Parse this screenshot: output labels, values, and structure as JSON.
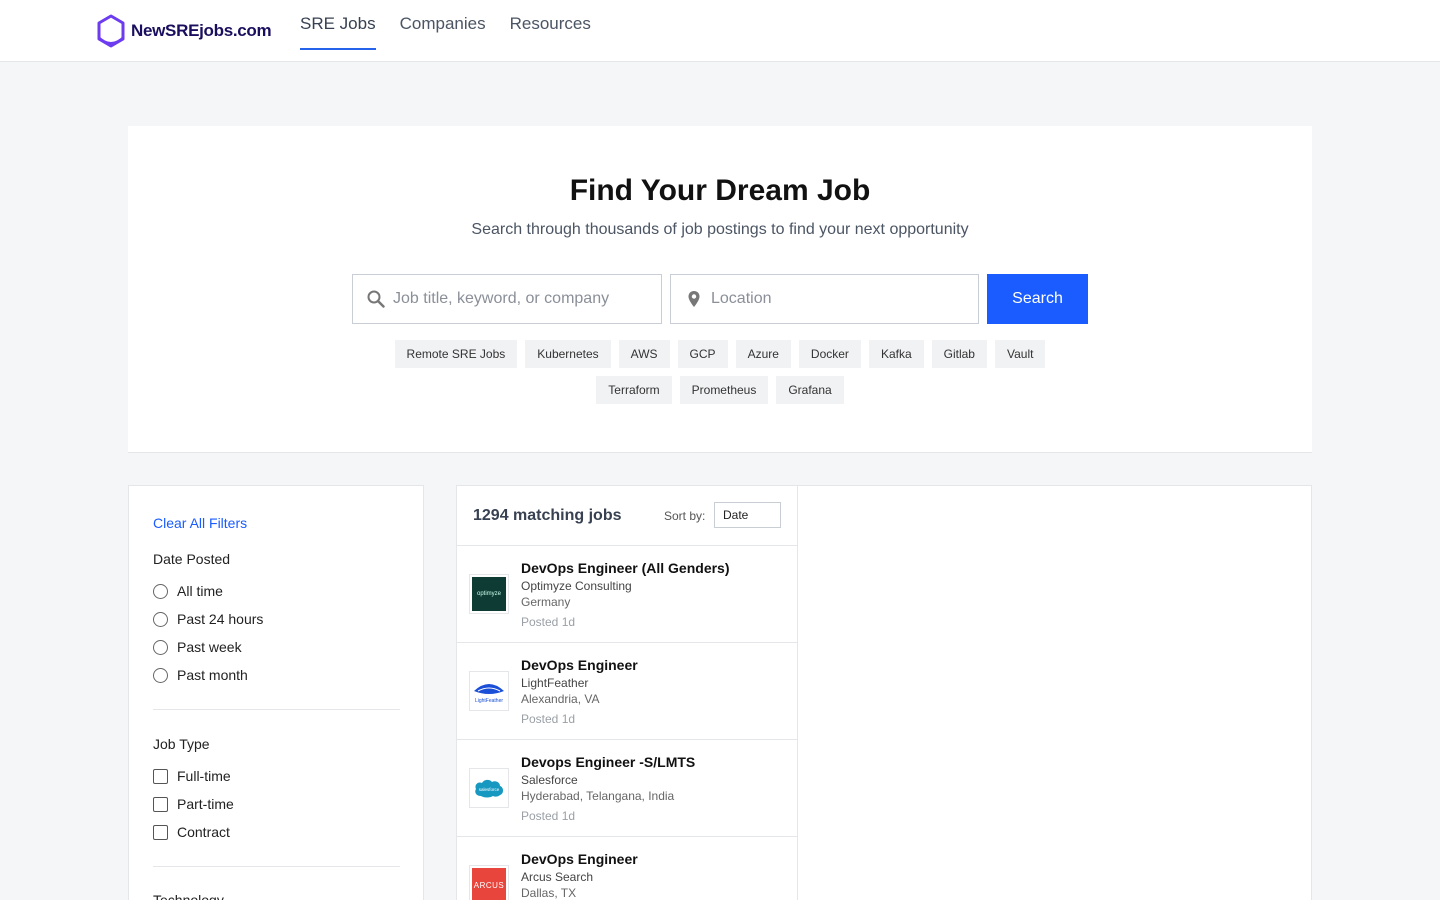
{
  "brand": {
    "name": "NewSREjobs.com",
    "accent": "#1a5cff",
    "logo_color": "#6d3cf0"
  },
  "nav": [
    {
      "label": "SRE Jobs",
      "active": true
    },
    {
      "label": "Companies",
      "active": false
    },
    {
      "label": "Resources",
      "active": false
    }
  ],
  "hero": {
    "title": "Find Your Dream Job",
    "subtitle": "Search through thousands of job postings to find your next opportunity",
    "keyword_placeholder": "Job title, keyword, or company",
    "location_placeholder": "Location",
    "search_label": "Search",
    "tags": [
      "Remote SRE Jobs",
      "Kubernetes",
      "AWS",
      "GCP",
      "Azure",
      "Docker",
      "Kafka",
      "Gitlab",
      "Vault",
      "Terraform",
      "Prometheus",
      "Grafana"
    ]
  },
  "filters": {
    "clear_label": "Clear All Filters",
    "date_posted": {
      "title": "Date Posted",
      "options": [
        "All time",
        "Past 24 hours",
        "Past week",
        "Past month"
      ]
    },
    "job_type": {
      "title": "Job Type",
      "options": [
        "Full-time",
        "Part-time",
        "Contract"
      ]
    },
    "technology": {
      "title": "Technology"
    }
  },
  "results": {
    "count_label": "1294 matching jobs",
    "sort_label": "Sort by:",
    "sort_value": "Date",
    "jobs": [
      {
        "title": "DevOps Engineer (All Genders)",
        "company": "Optimyze Consulting",
        "location": "Germany",
        "posted": "Posted 1d",
        "logo": "optimyze-logo"
      },
      {
        "title": "DevOps Engineer",
        "company": "LightFeather",
        "location": "Alexandria, VA",
        "posted": "Posted 1d",
        "logo": "lightfeather-logo"
      },
      {
        "title": "Devops Engineer -S/LMTS",
        "company": "Salesforce",
        "location": "Hyderabad, Telangana, India",
        "posted": "Posted 1d",
        "logo": "salesforce-logo"
      },
      {
        "title": "DevOps Engineer",
        "company": "Arcus Search",
        "location": "Dallas, TX",
        "posted": "",
        "logo": "arcus-logo"
      }
    ]
  }
}
